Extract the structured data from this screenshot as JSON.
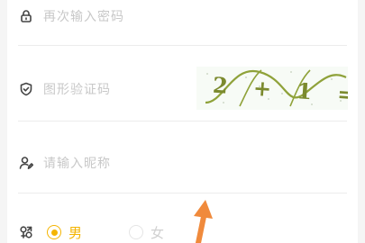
{
  "form": {
    "confirm_password_placeholder": "再次输入密码",
    "captcha_placeholder": "图形验证码",
    "captcha_text": "2 + 1 =",
    "nickname_placeholder": "请输入昵称",
    "gender": {
      "male_label": "男",
      "female_label": "女",
      "selected": "男"
    }
  },
  "icons": {
    "lock": "lock-icon",
    "shield": "shield-icon",
    "user_edit": "user-edit-icon",
    "gender": "gender-icon"
  },
  "colors": {
    "accent": "#f4b400",
    "placeholder": "#c8c8c8",
    "annotation_arrow": "#f08a3c"
  }
}
